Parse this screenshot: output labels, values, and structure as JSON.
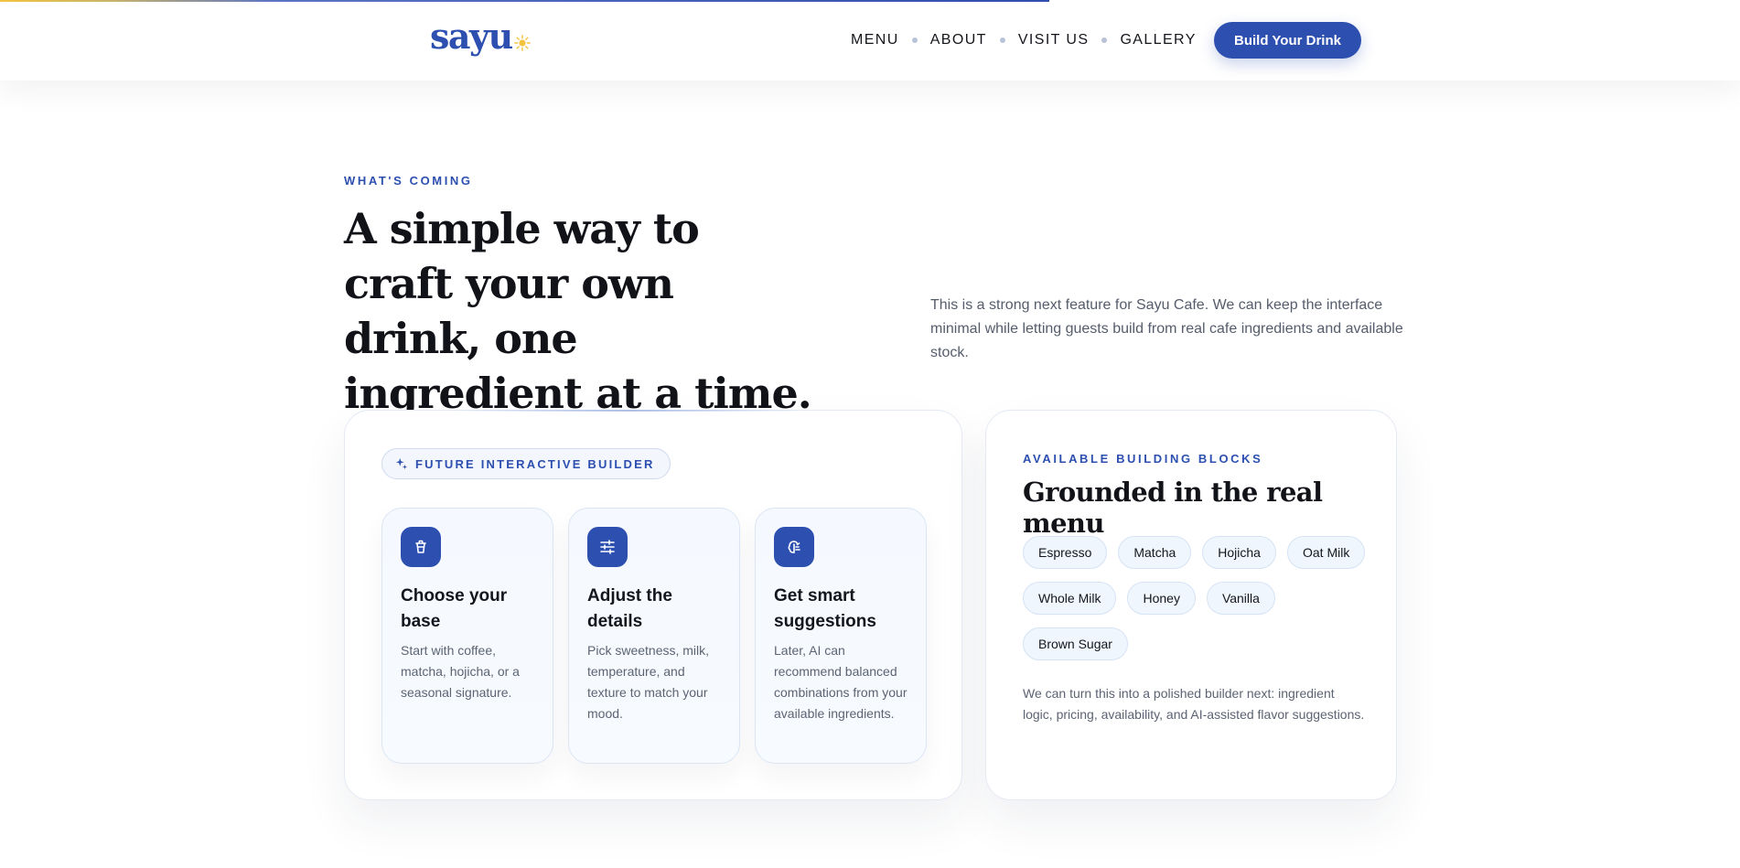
{
  "brand": {
    "logo_text": "sayu",
    "accent": "#2c4fb0",
    "sun_color": "#f3c33f",
    "logo_icon": "sun-icon"
  },
  "nav": {
    "items": [
      "MENU",
      "ABOUT",
      "VISIT US",
      "GALLERY"
    ],
    "cta_label": "Build Your Drink"
  },
  "intro": {
    "eyebrow": "WHAT'S COMING",
    "headline": "A simple way to craft your own drink, one ingredient at a time.",
    "copy": "This is a strong next feature for Sayu Cafe. We can keep the interface minimal while letting guests build from real cafe ingredients and available stock."
  },
  "builder": {
    "badge": "FUTURE INTERACTIVE BUILDER",
    "badge_icon": "sparkles-icon",
    "steps": [
      {
        "icon": "cup-icon",
        "title": "Choose your base",
        "text": "Start with coffee, matcha, hojicha, or a seasonal signature."
      },
      {
        "icon": "sliders-icon",
        "title": "Adjust the details",
        "text": "Pick sweetness, milk, temperature, and texture to match your mood."
      },
      {
        "icon": "brain-icon",
        "title": "Get smart suggestions",
        "text": "Later, AI can recommend balanced combinations from your available ingredients."
      }
    ]
  },
  "blocks": {
    "eyebrow": "AVAILABLE BUILDING BLOCKS",
    "title": "Grounded in the real menu",
    "chips": [
      "Espresso",
      "Matcha",
      "Hojicha",
      "Oat Milk",
      "Whole Milk",
      "Honey",
      "Vanilla",
      "Brown Sugar"
    ],
    "note": "We can turn this into a polished builder next: ingredient logic, pricing, availability, and AI-assisted flavor suggestions."
  }
}
